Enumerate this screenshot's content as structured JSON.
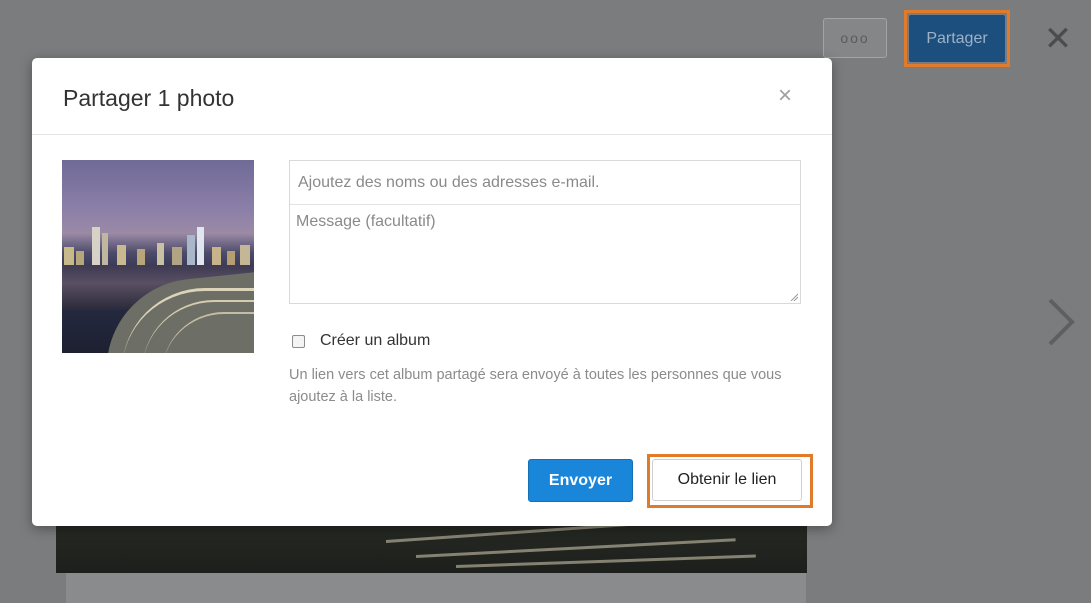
{
  "toolbar": {
    "more_label": "ooo",
    "share_label": "Partager"
  },
  "dialog": {
    "title": "Partager 1 photo",
    "recipients_placeholder": "Ajoutez des noms ou des adresses e-mail.",
    "message_placeholder": "Message (facultatif)",
    "create_album_label": "Créer un album",
    "create_album_checked": false,
    "help_text": "Un lien vers cet album partagé sera envoyé à toutes les personnes que vous ajoutez à la liste.",
    "send_label": "Envoyer",
    "get_link_label": "Obtenir le lien"
  },
  "colors": {
    "primary": "#1a86d9",
    "highlight": "#e07b2b",
    "share_button": "#1d4f7e"
  },
  "icons": {
    "close_dialog": "close-icon",
    "close_viewer": "close-icon",
    "next": "chevron-right-icon"
  }
}
